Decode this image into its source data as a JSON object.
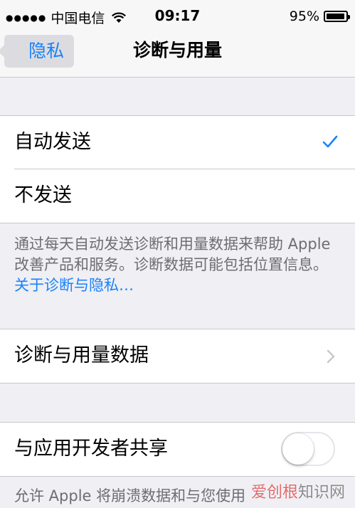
{
  "status_bar": {
    "signal_dots": "●●●●●",
    "carrier": "中国电信",
    "wifi_icon": "wifi-icon",
    "time": "09:17",
    "battery_percent": "95%",
    "battery_level": 0.95
  },
  "nav": {
    "back_label": "隐私",
    "title": "诊断与用量"
  },
  "send_options": {
    "items": [
      {
        "label": "自动发送",
        "selected": true
      },
      {
        "label": "不发送",
        "selected": false
      }
    ]
  },
  "send_footer": {
    "text": "通过每天自动发送诊断和用量数据来帮助 Apple 改善产品和服务。诊断数据可能包括位置信息。",
    "link": "关于诊断与隐私…"
  },
  "usage_data": {
    "label": "诊断与用量数据"
  },
  "share": {
    "label": "与应用开发者共享",
    "enabled": false
  },
  "share_footer": {
    "text": "允许 Apple 将崩溃数据和与您使用"
  },
  "watermark": {
    "part1": "爱创根",
    "part2": "知识网"
  },
  "colors": {
    "accent": "#1a82fb",
    "background": "#efeff4",
    "separator": "#c8c7cc",
    "footer_text": "#6d6d72"
  }
}
